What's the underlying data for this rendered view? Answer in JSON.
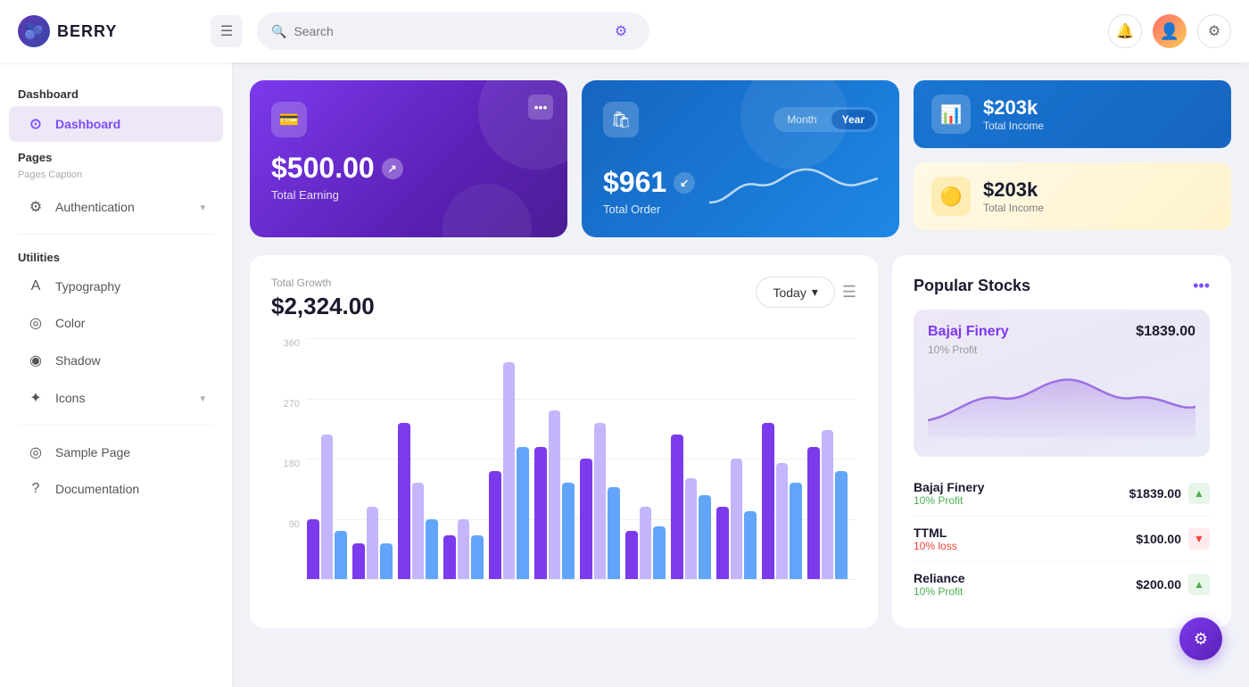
{
  "app": {
    "name": "BERRY",
    "logo_emoji": "🫐"
  },
  "header": {
    "search_placeholder": "Search",
    "hamburger_label": "Toggle menu",
    "notification_icon": "bell",
    "settings_icon": "gear",
    "avatar_icon": "👤"
  },
  "sidebar": {
    "sections": [
      {
        "title": "Dashboard",
        "items": [
          {
            "label": "Dashboard",
            "icon": "⊙",
            "active": true
          }
        ]
      },
      {
        "title": "Pages",
        "caption": "Pages Caption",
        "items": [
          {
            "label": "Authentication",
            "icon": "⚙",
            "has_chevron": true
          }
        ]
      },
      {
        "title": "Utilities",
        "items": [
          {
            "label": "Typography",
            "icon": "A"
          },
          {
            "label": "Color",
            "icon": "◎"
          },
          {
            "label": "Shadow",
            "icon": "◉"
          },
          {
            "label": "Icons",
            "icon": "✦",
            "has_chevron": true
          }
        ]
      },
      {
        "title": "",
        "items": [
          {
            "label": "Sample Page",
            "icon": "◎"
          },
          {
            "label": "Documentation",
            "icon": "?"
          }
        ]
      }
    ]
  },
  "cards": {
    "total_earning": {
      "amount": "$500.00",
      "label": "Total Earning",
      "icon": "💳"
    },
    "total_order": {
      "amount": "$961",
      "label": "Total Order",
      "icon": "🛍",
      "toggle": {
        "month": "Month",
        "year": "Year",
        "active": "Year"
      }
    },
    "total_income_blue": {
      "amount": "$203k",
      "label": "Total Income",
      "icon": "📊"
    },
    "total_income_yellow": {
      "amount": "$203k",
      "label": "Total Income",
      "icon": "💰"
    }
  },
  "chart": {
    "title": "Total Growth",
    "total": "$2,324.00",
    "period_btn": "Today",
    "y_labels": [
      "360",
      "270",
      "180",
      "90",
      ""
    ],
    "bars": [
      {
        "purple": 25,
        "light": 60,
        "blue": 20
      },
      {
        "purple": 15,
        "light": 30,
        "blue": 15
      },
      {
        "purple": 65,
        "light": 40,
        "blue": 25
      },
      {
        "purple": 18,
        "light": 25,
        "blue": 18
      },
      {
        "purple": 45,
        "light": 90,
        "blue": 55
      },
      {
        "purple": 55,
        "light": 70,
        "blue": 40
      },
      {
        "purple": 50,
        "light": 65,
        "blue": 38
      },
      {
        "purple": 20,
        "light": 30,
        "blue": 22
      },
      {
        "purple": 60,
        "light": 42,
        "blue": 35
      },
      {
        "purple": 30,
        "light": 50,
        "blue": 28
      },
      {
        "purple": 65,
        "light": 48,
        "blue": 40
      },
      {
        "purple": 55,
        "light": 62,
        "blue": 45
      }
    ]
  },
  "stocks": {
    "title": "Popular Stocks",
    "featured": {
      "name": "Bajaj Finery",
      "price": "$1839.00",
      "profit_label": "10% Profit"
    },
    "items": [
      {
        "name": "Bajaj Finery",
        "profit": "10% Profit",
        "profit_type": "green",
        "price": "$1839.00",
        "trend": "up"
      },
      {
        "name": "TTML",
        "profit": "10% loss",
        "profit_type": "red",
        "price": "$100.00",
        "trend": "down"
      },
      {
        "name": "Reliance",
        "profit": "10% Profit",
        "profit_type": "green",
        "price": "$200.00",
        "trend": "up"
      }
    ]
  }
}
